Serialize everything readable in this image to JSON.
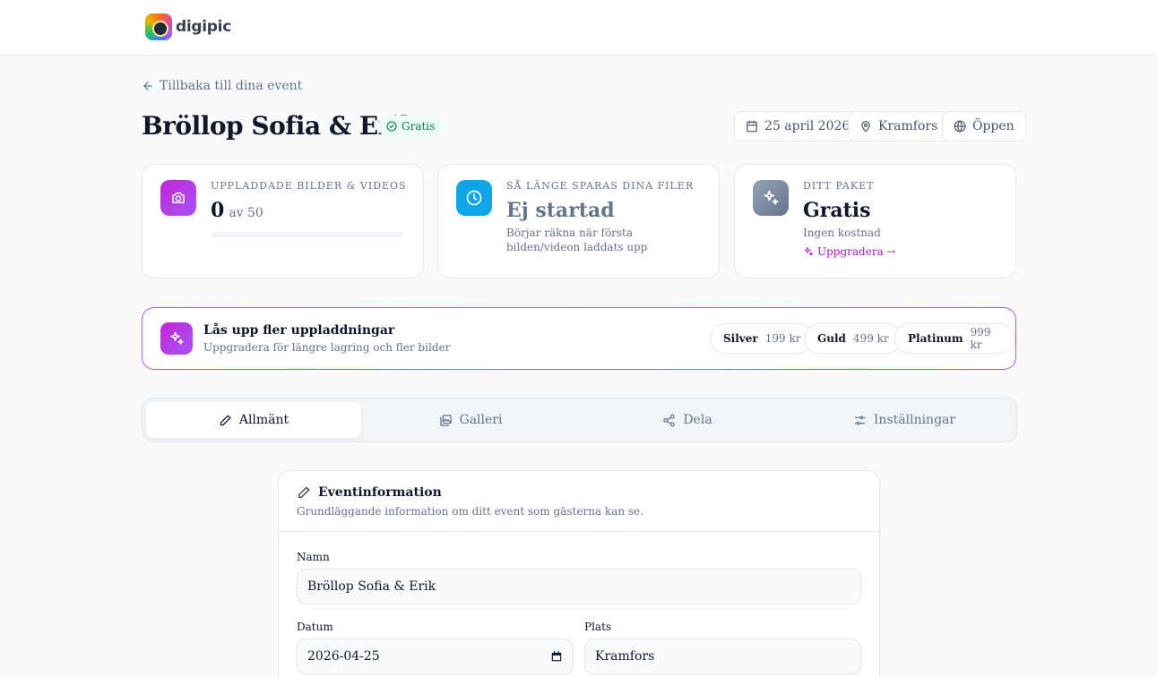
{
  "brand": {
    "name": "digipic"
  },
  "nav": {
    "back_label": "Tillbaka till dina event"
  },
  "event": {
    "title": "Bröllop Sofia & Erik",
    "package_badge": "Gratis",
    "date": "25 april 2026",
    "location": "Kramfors",
    "visibility": "Öppen"
  },
  "stats": {
    "uploads": {
      "label": "UPPLADDADE BILDER & VIDEOS",
      "count": "0",
      "limit": "av 50",
      "progress": 0
    },
    "storage": {
      "label": "SÅ LÄNGE SPARAS DINA FILER",
      "value": "Ej startad",
      "sub": "Börjar räkna när första bilden/videon laddats upp"
    },
    "package": {
      "label": "DITT PAKET",
      "value": "Gratis",
      "sub": "Ingen kostnad",
      "upgrade_link": "Uppgradera →"
    }
  },
  "upsell": {
    "title": "Lås upp fler uppladdningar",
    "subtitle": "Uppgradera för längre lagring och fler bilder",
    "plans": [
      {
        "name": "Silver",
        "price": "199 kr"
      },
      {
        "name": "Guld",
        "price": "499 kr"
      },
      {
        "name": "Platinum",
        "price": "999 kr"
      }
    ]
  },
  "tabs": [
    {
      "label": "Allmänt",
      "icon": "pencil-icon",
      "active": true
    },
    {
      "label": "Galleri",
      "icon": "gallery-icon",
      "active": false
    },
    {
      "label": "Dela",
      "icon": "share-icon",
      "active": false
    },
    {
      "label": "Inställningar",
      "icon": "sliders-icon",
      "active": false
    }
  ],
  "form": {
    "title": "Eventinformation",
    "description": "Grundläggande information om ditt event som gästerna kan se.",
    "name_label": "Namn",
    "name_value": "Bröllop Sofia & Erik",
    "date_label": "Datum",
    "date_value": "2026-04-25",
    "place_label": "Plats",
    "place_value": "Kramfors"
  },
  "colors": {
    "accent_purple": "#a855f7",
    "accent_cyan": "#0ea5e9",
    "badge_green": "#047857",
    "slate_icon": "#64748b"
  }
}
